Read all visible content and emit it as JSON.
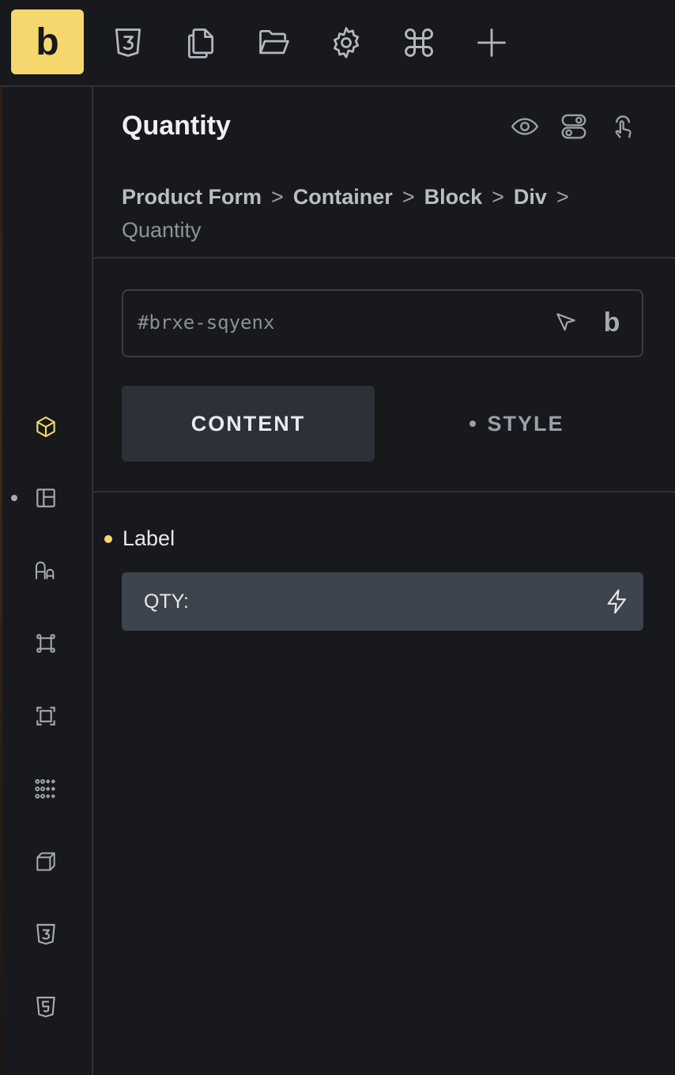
{
  "toolbar": {
    "logo_letter": "b",
    "buttons": [
      {
        "icon": "css3-icon"
      },
      {
        "icon": "pages-icon"
      },
      {
        "icon": "folder-open-icon"
      },
      {
        "icon": "gear-icon"
      },
      {
        "icon": "command-icon"
      },
      {
        "icon": "plus-icon"
      }
    ]
  },
  "rail": {
    "items": [
      {
        "icon": "box-icon",
        "active": true,
        "color": "#f5d76e"
      },
      {
        "icon": "layout-icon",
        "dot": true
      },
      {
        "icon": "typography-icon"
      },
      {
        "icon": "spacing-icon"
      },
      {
        "icon": "border-icon"
      },
      {
        "icon": "grid-dots-icon"
      },
      {
        "icon": "transform-cube-icon"
      },
      {
        "icon": "css3-icon"
      },
      {
        "icon": "html5-icon"
      }
    ]
  },
  "panel": {
    "title": "Quantity",
    "header_icons": [
      "eye-icon",
      "toggle-icon",
      "pointer-hand-icon"
    ],
    "breadcrumb": {
      "items": [
        "Product Form",
        "Container",
        "Block",
        "Div"
      ],
      "separator": ">",
      "current": "Quantity"
    },
    "element_id": "#brxe-sqyenx",
    "element_id_actions": {
      "selector_icon": "cursor-arrow-icon",
      "brand_letter": "b"
    },
    "tabs": [
      {
        "label": "CONTENT",
        "active": true
      },
      {
        "label": "STYLE",
        "active": false
      }
    ],
    "controls": [
      {
        "label": "Label",
        "value": "QTY:",
        "icon": "lightning-icon"
      }
    ]
  },
  "colors": {
    "accent": "#f5d76e",
    "background": "#17191d",
    "field": "#3e444d"
  }
}
